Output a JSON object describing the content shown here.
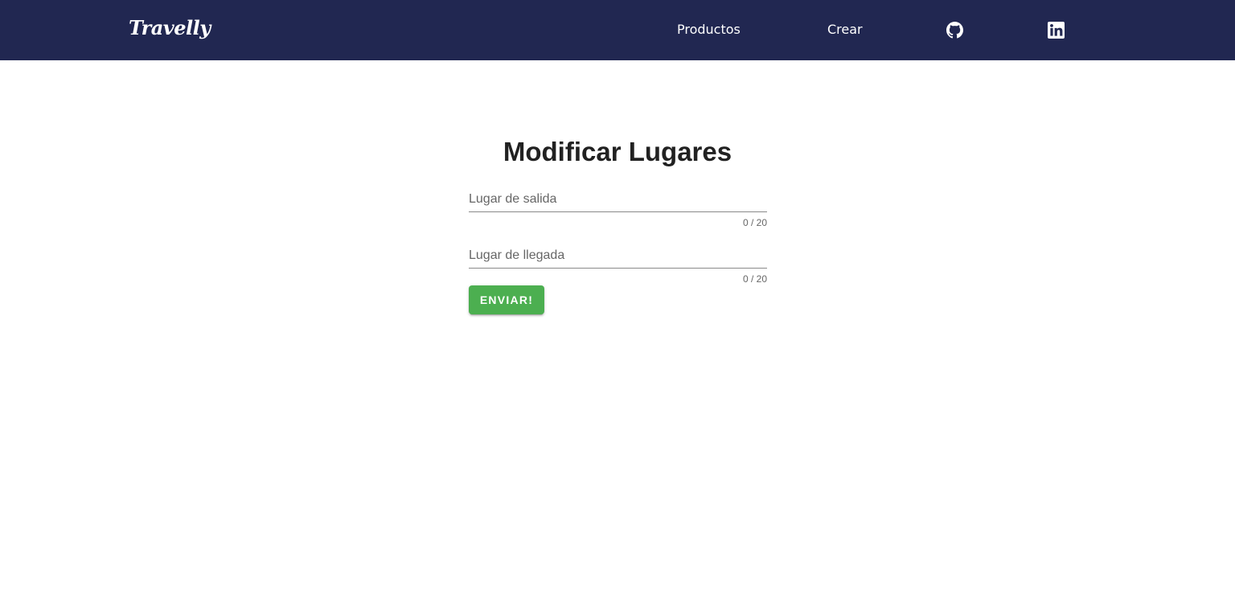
{
  "navbar": {
    "brand": "Travelly",
    "links": [
      {
        "label": "Productos"
      },
      {
        "label": "Crear"
      }
    ],
    "icons": [
      "github-icon",
      "linkedin-icon"
    ],
    "background_color": "#212751"
  },
  "form": {
    "title": "Modificar Lugares",
    "fields": [
      {
        "placeholder": "Lugar de salida",
        "value": "",
        "counter": "0 / 20"
      },
      {
        "placeholder": "Lugar de llegada",
        "value": "",
        "counter": "0 / 20"
      }
    ],
    "submit_label": "ENVIAR!",
    "submit_color": "#4caf50"
  }
}
